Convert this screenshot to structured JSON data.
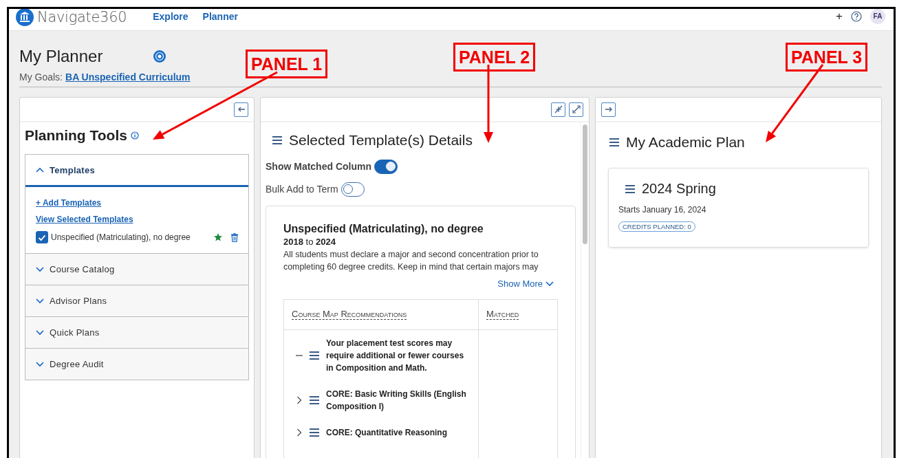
{
  "header": {
    "app_name": "Navigate360",
    "nav": [
      "Explore",
      "Planner"
    ],
    "add_button": "+",
    "avatar": "FA"
  },
  "page": {
    "title": "My Planner",
    "goals_label": "My Goals:",
    "goals_link": "BA Unspecified Curriculum"
  },
  "planning_tools": {
    "title": "Planning Tools",
    "sections": [
      {
        "label": "Templates",
        "expanded": true,
        "links": [
          "+ Add Templates",
          "View Selected Templates"
        ],
        "templates": [
          {
            "label": "Unspecified (Matriculating), no degree",
            "checked": true,
            "favorite": true
          }
        ]
      },
      {
        "label": "Course Catalog",
        "expanded": false
      },
      {
        "label": "Advisor Plans",
        "expanded": false
      },
      {
        "label": "Quick Plans",
        "expanded": false
      },
      {
        "label": "Degree Audit",
        "expanded": false
      }
    ]
  },
  "template_details": {
    "title": "Selected Template(s) Details",
    "toggles": [
      {
        "label": "Show Matched Column",
        "on": true
      },
      {
        "label": "Bulk Add to Term",
        "on": false
      }
    ],
    "template": {
      "title": "Unspecified (Matriculating), no degree",
      "years": "**2018** to **2024**",
      "description": "All students must declare a major and second concentration prior to completing 60 degree credits. Keep in mind that certain majors may",
      "show_more": "Show More",
      "table": {
        "columns": [
          "Course Map Recommendations",
          "Matched"
        ],
        "rows": [
          {
            "text": "Your placement test scores may require additional or fewer courses in Composition and Math.",
            "expanded": true
          },
          {
            "text": "CORE: Basic Writing Skills (English Composition I)",
            "expanded": false
          },
          {
            "text": "CORE: Quantitative Reasoning",
            "expanded": false
          }
        ]
      }
    }
  },
  "academic_plan": {
    "title": "My Academic Plan",
    "terms": [
      {
        "name": "2024 Spring",
        "starts": "Starts January 16, 2024",
        "credits": "CREDITS PLANNED: 0"
      }
    ]
  },
  "annotations": [
    {
      "label": "PANEL 1"
    },
    {
      "label": "PANEL 2"
    },
    {
      "label": "PANEL 3"
    }
  ]
}
